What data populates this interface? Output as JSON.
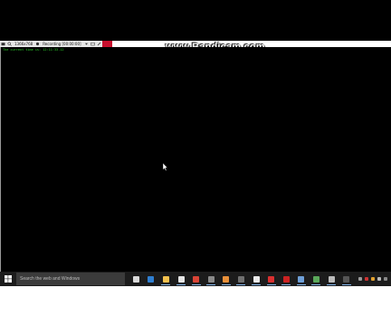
{
  "recorder": {
    "resolution_text": "1366x768",
    "status_text": "Recording [00:00:00]",
    "watermark": "www.Bandicam.com"
  },
  "console": {
    "line": "The current time is: 12:11:33.12"
  },
  "taskbar": {
    "search_placeholder": "Search the web and Windows",
    "apps": [
      {
        "name": "task-view",
        "color": "#d9d9d9"
      },
      {
        "name": "edge",
        "color": "#2f7fd1"
      },
      {
        "name": "file-explorer",
        "color": "#f2c14e"
      },
      {
        "name": "store",
        "color": "#e6e6e6"
      },
      {
        "name": "chrome",
        "color": "#d94436"
      },
      {
        "name": "calculator",
        "color": "#8a8a8a"
      },
      {
        "name": "paint",
        "color": "#e8903a"
      },
      {
        "name": "media",
        "color": "#707070"
      },
      {
        "name": "notepad",
        "color": "#eaeaea"
      },
      {
        "name": "acrobat",
        "color": "#d93030"
      },
      {
        "name": "opera",
        "color": "#cc2222"
      },
      {
        "name": "network",
        "color": "#6fa0d8"
      },
      {
        "name": "control-panel",
        "color": "#5aa85a"
      },
      {
        "name": "settings",
        "color": "#bcbcbc"
      },
      {
        "name": "cmd",
        "color": "#555555"
      }
    ],
    "tray_colors": [
      "#9a9a9a",
      "#cc3333",
      "#e0a030",
      "#bbbbbb",
      "#888888"
    ]
  },
  "colors": {
    "recording_red": "#c8102e",
    "console_green": "#2bd12b"
  }
}
